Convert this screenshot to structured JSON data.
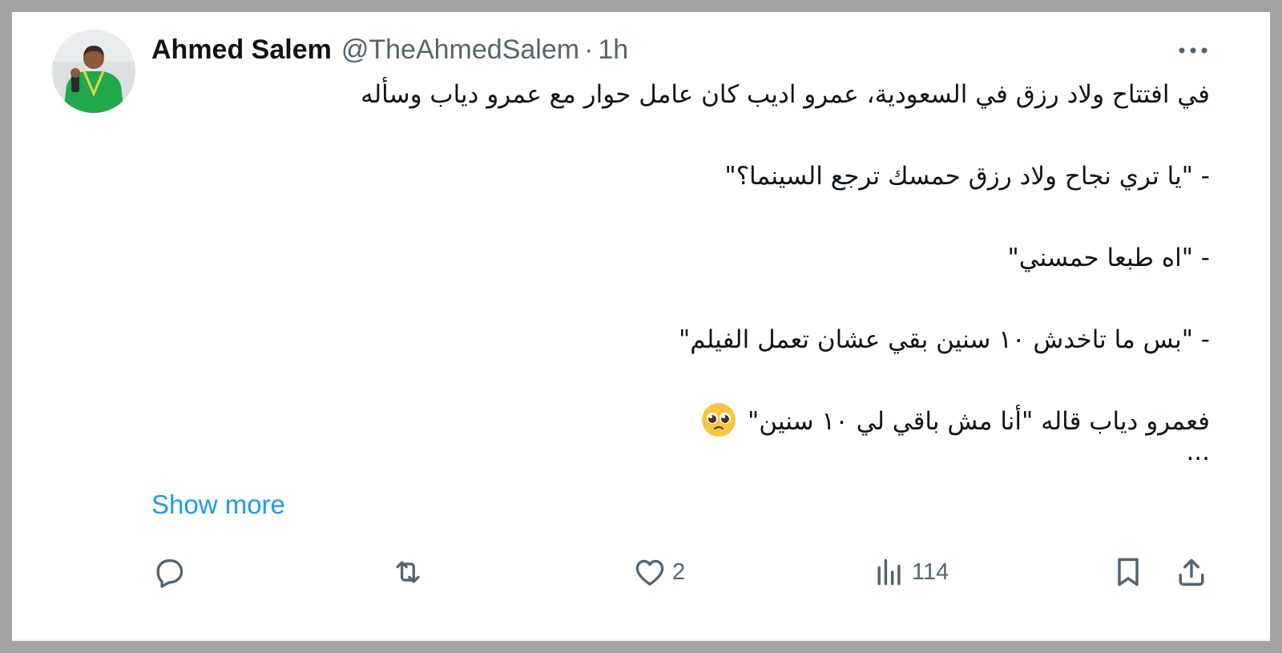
{
  "tweet": {
    "author_name": "Ahmed Salem",
    "handle": "@TheAhmedSalem",
    "separator": "·",
    "time": "1h",
    "lines": [
      "في افتتاح ولاد رزق في السعودية، عمرو اديب كان عامل حوار مع عمرو دياب وسأله",
      "-  \"يا تري نجاح ولاد رزق حمسك ترجع السينما؟\"",
      "- \"اه طبعا حمسني\"",
      "- \"بس ما تاخدش ١٠ سنين بقي عشان تعمل الفيلم\"",
      "فعمرو دياب قاله \"أنا مش باقي لي ١٠ سنين\""
    ],
    "ellipsis": "...",
    "show_more": "Show more"
  },
  "actions": {
    "reply": {
      "icon": "reply-icon",
      "count": ""
    },
    "retweet": {
      "icon": "retweet-icon",
      "count": ""
    },
    "like": {
      "icon": "heart-icon",
      "count": "2"
    },
    "views": {
      "icon": "views-icon",
      "count": "114"
    },
    "bookmark": {
      "icon": "bookmark-icon"
    },
    "share": {
      "icon": "share-icon"
    }
  },
  "colors": {
    "text": "#0f1419",
    "secondary": "#536471",
    "link": "#1d9bf0",
    "avatar_shirt": "#1faa4b"
  }
}
